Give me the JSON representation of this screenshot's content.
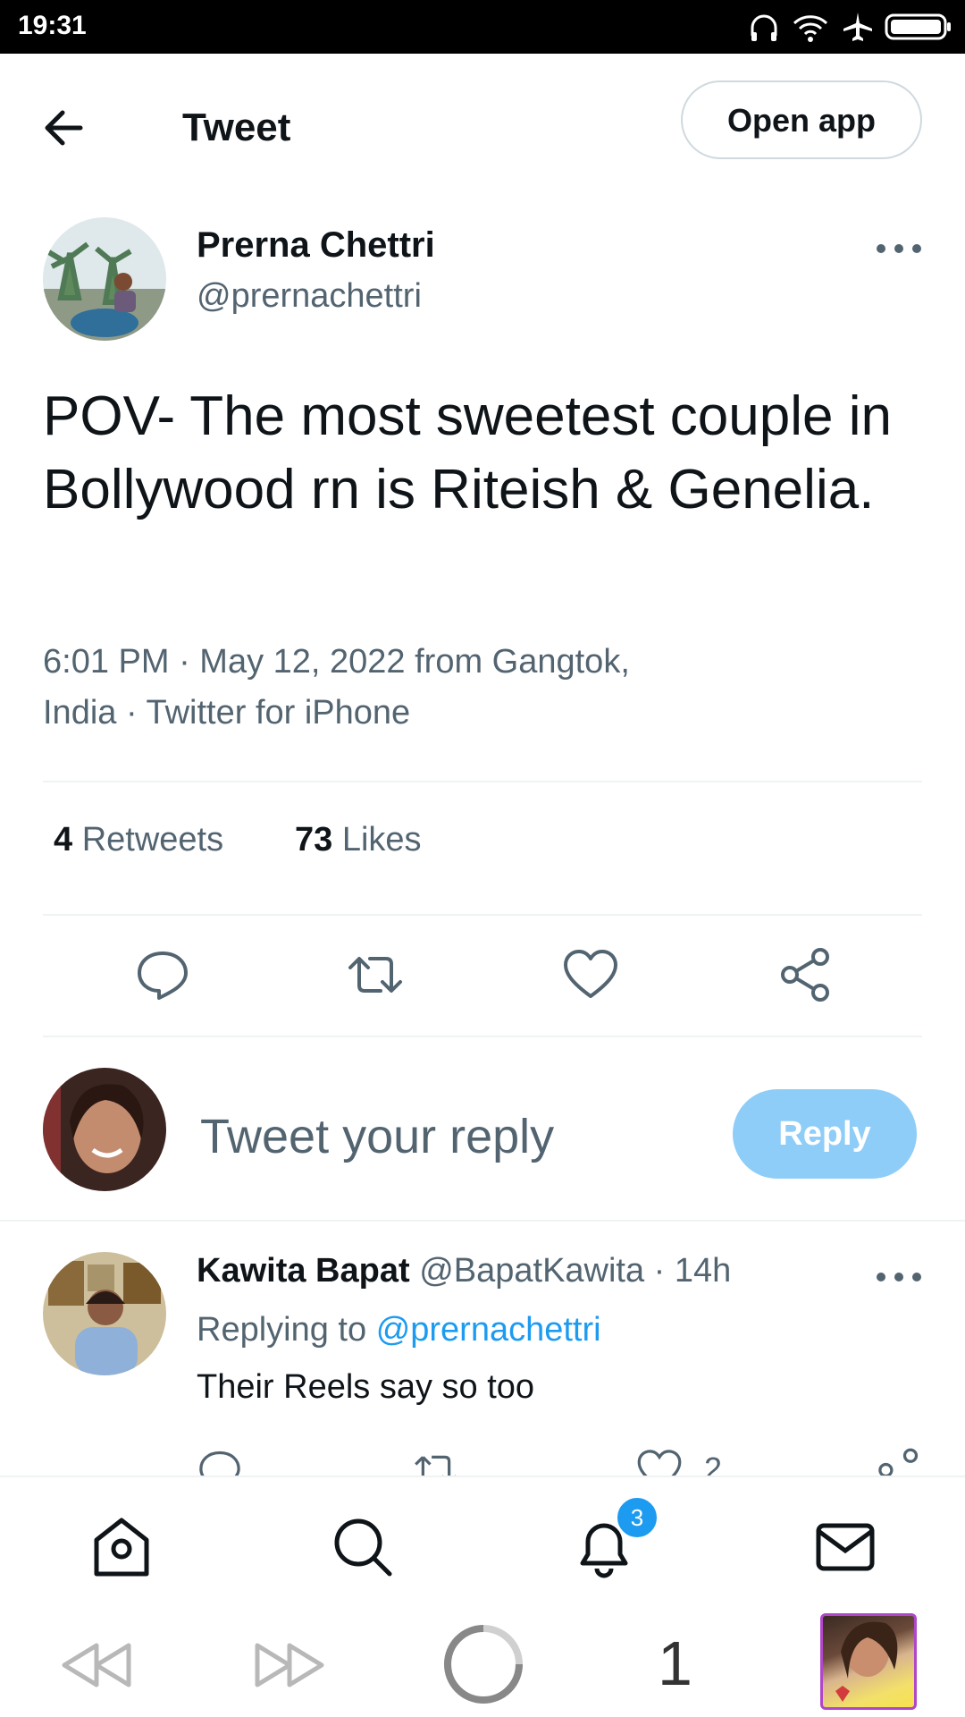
{
  "status_bar": {
    "time": "19:31"
  },
  "header": {
    "title": "Tweet",
    "open_app_label": "Open app"
  },
  "tweet": {
    "author_name": "Prerna Chettri",
    "author_handle": "@prernachettri",
    "text": "POV- The most sweetest couple in Bollywood rn is Riteish & Genelia.",
    "meta_line1": "6:01 PM · May 12, 2022 from Gangtok,",
    "meta_line2": "India · Twitter for iPhone",
    "retweets_count": "4",
    "retweets_label": "Retweets",
    "likes_count": "73",
    "likes_label": "Likes"
  },
  "reply_box": {
    "placeholder": "Tweet your reply",
    "button_label": "Reply"
  },
  "reply": {
    "name": "Kawita Bapat",
    "handle_time": "@BapatKawita · 14h",
    "replying_prefix": "Replying to",
    "replying_handle": "@prernachettri",
    "text": "Their Reels say so too",
    "like_count": "2"
  },
  "nav": {
    "notification_badge": "3"
  },
  "browser": {
    "tab_count": "1"
  },
  "colors": {
    "accent": "#1d9bf0",
    "reply_button": "#8ecdf7",
    "secondary_text": "#536471"
  },
  "icons": [
    "back-arrow-icon",
    "more-icon",
    "reply-icon",
    "retweet-icon",
    "like-icon",
    "share-icon",
    "home-icon",
    "search-icon",
    "bell-icon",
    "mail-icon",
    "browser-back-icon",
    "browser-forward-icon",
    "reload-icon"
  ]
}
